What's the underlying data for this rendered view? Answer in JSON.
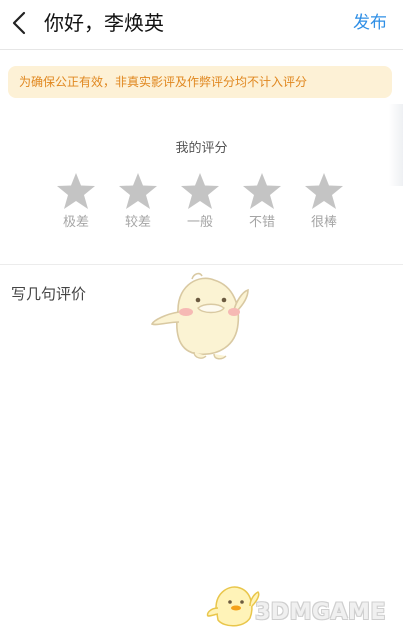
{
  "header": {
    "title": "你好，李焕英",
    "publish_label": "发布"
  },
  "notice": {
    "text": "为确保公正有效，非真实影评及作弊评分均不计入评分",
    "color": "#e0871f",
    "background": "#fdf1d6"
  },
  "rating": {
    "title": "我的评分",
    "selected_stars": 0,
    "star_color": "#c4c4c4",
    "stars": [
      {
        "label": "极差"
      },
      {
        "label": "较差"
      },
      {
        "label": "一般"
      },
      {
        "label": "不错"
      },
      {
        "label": "很棒"
      }
    ]
  },
  "comment": {
    "placeholder": "写几句评价"
  },
  "watermark": {
    "text": "3DMGAME"
  },
  "colors": {
    "accent": "#2f8fe6"
  }
}
